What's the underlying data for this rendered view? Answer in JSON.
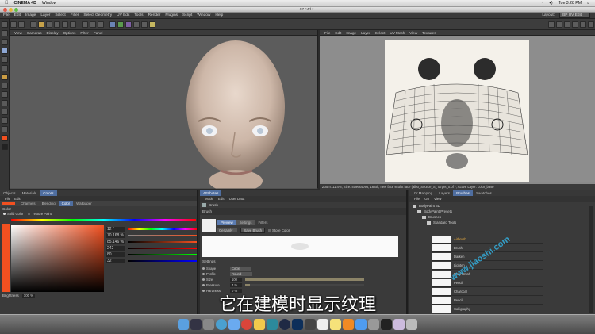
{
  "mac_menubar": {
    "app": "CINEMA 4D",
    "items": [
      "Window"
    ],
    "clock": "Tue 3:28 PM"
  },
  "window": {
    "title": "07.c4d *"
  },
  "app_menu": {
    "items": [
      "File",
      "Edit",
      "Image",
      "Layer",
      "Select",
      "Filter",
      "Select Geometry",
      "UV Edit",
      "Tools",
      "Render",
      "Plugins",
      "Script",
      "Window",
      "Help"
    ],
    "layout_label": "Layout:",
    "layout_value": "BP UV Edit"
  },
  "viewport_3d": {
    "menu": [
      "View",
      "Cameras",
      "Display",
      "Options",
      "Filter",
      "Panel"
    ]
  },
  "uv_view": {
    "menu": [
      "File",
      "Edit",
      "Image",
      "Layer",
      "Select",
      "UV Mesh",
      "View",
      "Textures"
    ],
    "status": "Zoom: 11.4%, Size: 4096x4096, 16 Bit, new face sculpt face (albo_Source_S_Target_0.of *, Active Layer: color_base"
  },
  "color_panel": {
    "tabs": [
      "Objects",
      "Materials",
      "Colors"
    ],
    "menu": [
      "File",
      "Edit"
    ],
    "subtabs": [
      "Channels",
      "Blending",
      "Color",
      "Wallpaper"
    ],
    "section": "Color",
    "solid_color_label": "Solid Color",
    "texture_paint_label": "Texture Paint",
    "hsv_values": [
      "12 °",
      "70.168 %",
      "85.146 %"
    ],
    "rgb_values": [
      "242",
      "80",
      "32"
    ],
    "brightness_label": "Brightness",
    "brightness_value": "100 %"
  },
  "attributes": {
    "tab": "Attributes",
    "menu": [
      "Mode",
      "Edit",
      "User Data"
    ],
    "object_label": "Brush",
    "brush_section": "Brush",
    "brush_tabs": [
      "Preview",
      "Settings",
      "Filters"
    ],
    "category_label": "Certainly",
    "save_brush": "Save Brush",
    "store_color": "Store Color",
    "settings_section": "Settings",
    "settings": [
      {
        "label": "Shape",
        "value": "Circle"
      },
      {
        "label": "Profile",
        "value": "Round"
      },
      {
        "label": "Size",
        "value": "100"
      },
      {
        "label": "Pressure",
        "value": "4 %"
      },
      {
        "label": "Hardness",
        "value": "0 %"
      }
    ]
  },
  "content_browser": {
    "tabs": [
      "UV Mapping",
      "Layers",
      "Brushes",
      "Swatches"
    ],
    "menu": [
      "File",
      "Go",
      "View"
    ],
    "tree": [
      "BodyPaint 3D",
      "BodyPaint Presets",
      "Brushes",
      "Standard Tools"
    ],
    "brushes": [
      "Airbrush",
      "Brush",
      "Darken",
      "Lighten",
      "Pixel Brush",
      "Pencil",
      "Charcoal",
      "Pencil",
      "Calligraphy"
    ]
  },
  "watermark": "www.jiaoshi.com",
  "subtitle": "它在建模时显示纹理",
  "colors": {
    "accent": "#4f6ea0",
    "selected_color": "#f25020",
    "selected_tab": "#5b7bb0"
  }
}
